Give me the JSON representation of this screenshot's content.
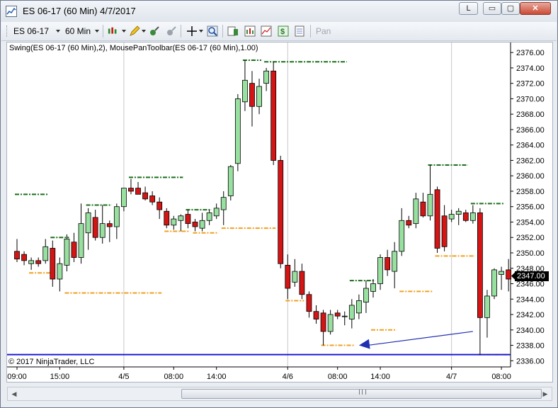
{
  "window": {
    "title": "ES 06-17 (60 Min)  4/7/2017",
    "buttons": {
      "l": "L",
      "minimize": "▭",
      "maximize": "▢",
      "close": "✕"
    }
  },
  "toolbar": {
    "instrument": "ES 06-17",
    "interval": "60 Min",
    "pan_label": "Pan",
    "icons": [
      "bar-type-icon",
      "drawing-pencil-icon",
      "strategy-icon",
      "indicator-icon",
      "crosshair-icon",
      "zoom-icon",
      "data-box-icon",
      "chart-properties-icon",
      "trade-icon",
      "dollar-icon",
      "template-icon"
    ]
  },
  "chart": {
    "indicator_label": "Swing(ES 06-17 (60 Min),2), MousePanToolbar(ES 06-17 (60 Min),1.00)",
    "copyright": "© 2017 NinjaTrader, LLC",
    "last_price": "2347.00",
    "colors": {
      "up": "#98e0a0",
      "down": "#d31515",
      "swing_high": "#1a6e1a",
      "swing_low": "#f0a020",
      "reference_line": "#1a1ad0",
      "arrow": "#2030b0"
    }
  },
  "chart_data": {
    "type": "candlestick",
    "instrument": "ES 06-17",
    "interval": "60 Min",
    "y_ticks": [
      2336,
      2338,
      2340,
      2342,
      2344,
      2346,
      2348,
      2350,
      2352,
      2354,
      2356,
      2358,
      2360,
      2362,
      2364,
      2366,
      2368,
      2370,
      2372,
      2374,
      2376
    ],
    "y_tick_labels": [
      "2336.00",
      "2338.00",
      "2340.00",
      "2342.00",
      "2344.00",
      "2346.00",
      "2348.00",
      "2350.00",
      "2352.00",
      "2354.00",
      "2356.00",
      "2358.00",
      "2360.00",
      "2362.00",
      "2364.00",
      "2366.00",
      "2368.00",
      "2370.00",
      "2372.00",
      "2374.00",
      "2376.00"
    ],
    "ylim": [
      2335.2,
      2377.3
    ],
    "x_labels": [
      "09:00",
      "15:00",
      "4/5",
      "08:00",
      "14:00",
      "4/6",
      "08:00",
      "14:00",
      "4/7",
      "08:00"
    ],
    "x_label_bars": [
      0,
      6,
      15,
      22,
      28,
      38,
      45,
      51,
      61,
      68
    ],
    "separator_bars": [
      15,
      38,
      61
    ],
    "candles": [
      {
        "o": 2350.2,
        "h": 2351.8,
        "l": 2348.8,
        "c": 2349.2
      },
      {
        "o": 2349.8,
        "h": 2350.2,
        "l": 2348.4,
        "c": 2349.0
      },
      {
        "o": 2348.6,
        "h": 2349.4,
        "l": 2347.8,
        "c": 2349.0
      },
      {
        "o": 2349.0,
        "h": 2349.4,
        "l": 2348.2,
        "c": 2348.6
      },
      {
        "o": 2349.0,
        "h": 2351.8,
        "l": 2348.6,
        "c": 2350.8
      },
      {
        "o": 2350.6,
        "h": 2351.6,
        "l": 2345.6,
        "c": 2346.6
      },
      {
        "o": 2346.6,
        "h": 2349.4,
        "l": 2345.0,
        "c": 2348.6
      },
      {
        "o": 2348.4,
        "h": 2352.4,
        "l": 2347.6,
        "c": 2351.8
      },
      {
        "o": 2351.4,
        "h": 2352.6,
        "l": 2348.8,
        "c": 2349.4
      },
      {
        "o": 2349.4,
        "h": 2356.4,
        "l": 2348.6,
        "c": 2353.8
      },
      {
        "o": 2352.6,
        "h": 2355.8,
        "l": 2350.4,
        "c": 2355.2
      },
      {
        "o": 2354.6,
        "h": 2355.6,
        "l": 2351.6,
        "c": 2352.0
      },
      {
        "o": 2352.0,
        "h": 2356.2,
        "l": 2351.2,
        "c": 2353.8
      },
      {
        "o": 2353.8,
        "h": 2354.2,
        "l": 2351.4,
        "c": 2353.4
      },
      {
        "o": 2353.4,
        "h": 2356.4,
        "l": 2351.8,
        "c": 2356.0
      },
      {
        "o": 2356.0,
        "h": 2358.4,
        "l": 2355.4,
        "c": 2358.4
      },
      {
        "o": 2358.4,
        "h": 2359.6,
        "l": 2357.6,
        "c": 2358.0
      },
      {
        "o": 2358.4,
        "h": 2359.2,
        "l": 2357.6,
        "c": 2357.6
      },
      {
        "o": 2357.8,
        "h": 2358.6,
        "l": 2356.8,
        "c": 2357.0
      },
      {
        "o": 2357.4,
        "h": 2358.0,
        "l": 2356.2,
        "c": 2356.6
      },
      {
        "o": 2356.6,
        "h": 2357.2,
        "l": 2354.4,
        "c": 2355.6
      },
      {
        "o": 2355.4,
        "h": 2355.8,
        "l": 2353.2,
        "c": 2353.6
      },
      {
        "o": 2353.6,
        "h": 2354.8,
        "l": 2353.0,
        "c": 2354.4
      },
      {
        "o": 2354.2,
        "h": 2355.0,
        "l": 2352.8,
        "c": 2354.8
      },
      {
        "o": 2355.0,
        "h": 2355.6,
        "l": 2353.2,
        "c": 2353.8
      },
      {
        "o": 2354.0,
        "h": 2354.4,
        "l": 2352.8,
        "c": 2353.4
      },
      {
        "o": 2353.2,
        "h": 2355.2,
        "l": 2352.8,
        "c": 2354.2
      },
      {
        "o": 2354.2,
        "h": 2355.6,
        "l": 2353.6,
        "c": 2355.2
      },
      {
        "o": 2354.8,
        "h": 2356.4,
        "l": 2354.4,
        "c": 2355.8
      },
      {
        "o": 2355.6,
        "h": 2358.0,
        "l": 2353.6,
        "c": 2357.2
      },
      {
        "o": 2357.4,
        "h": 2361.4,
        "l": 2356.8,
        "c": 2361.2
      },
      {
        "o": 2361.6,
        "h": 2370.6,
        "l": 2360.6,
        "c": 2370.0
      },
      {
        "o": 2369.6,
        "h": 2375.0,
        "l": 2368.4,
        "c": 2372.4
      },
      {
        "o": 2372.0,
        "h": 2373.6,
        "l": 2366.4,
        "c": 2369.0
      },
      {
        "o": 2369.0,
        "h": 2372.6,
        "l": 2368.0,
        "c": 2371.6
      },
      {
        "o": 2372.0,
        "h": 2374.0,
        "l": 2371.0,
        "c": 2373.6
      },
      {
        "o": 2373.6,
        "h": 2374.8,
        "l": 2361.4,
        "c": 2362.0
      },
      {
        "o": 2362.0,
        "h": 2362.6,
        "l": 2348.0,
        "c": 2348.6
      },
      {
        "o": 2348.4,
        "h": 2349.8,
        "l": 2344.0,
        "c": 2345.4
      },
      {
        "o": 2346.2,
        "h": 2349.2,
        "l": 2345.6,
        "c": 2347.6
      },
      {
        "o": 2347.6,
        "h": 2348.6,
        "l": 2344.0,
        "c": 2344.6
      },
      {
        "o": 2344.6,
        "h": 2345.0,
        "l": 2341.6,
        "c": 2342.4
      },
      {
        "o": 2342.4,
        "h": 2343.2,
        "l": 2340.8,
        "c": 2341.4
      },
      {
        "o": 2342.2,
        "h": 2342.6,
        "l": 2338.0,
        "c": 2339.8
      },
      {
        "o": 2339.8,
        "h": 2342.6,
        "l": 2339.4,
        "c": 2342.0
      },
      {
        "o": 2342.2,
        "h": 2342.6,
        "l": 2341.4,
        "c": 2341.8
      },
      {
        "o": 2341.8,
        "h": 2342.4,
        "l": 2340.6,
        "c": 2341.8
      },
      {
        "o": 2341.4,
        "h": 2344.0,
        "l": 2340.2,
        "c": 2343.2
      },
      {
        "o": 2342.2,
        "h": 2344.6,
        "l": 2341.4,
        "c": 2343.8
      },
      {
        "o": 2343.6,
        "h": 2346.4,
        "l": 2342.2,
        "c": 2345.4
      },
      {
        "o": 2345.0,
        "h": 2346.6,
        "l": 2344.2,
        "c": 2346.0
      },
      {
        "o": 2346.0,
        "h": 2349.8,
        "l": 2345.2,
        "c": 2349.4
      },
      {
        "o": 2349.4,
        "h": 2350.4,
        "l": 2347.0,
        "c": 2347.8
      },
      {
        "o": 2347.6,
        "h": 2351.4,
        "l": 2345.4,
        "c": 2350.2
      },
      {
        "o": 2350.2,
        "h": 2355.8,
        "l": 2349.6,
        "c": 2354.2
      },
      {
        "o": 2354.2,
        "h": 2354.8,
        "l": 2353.2,
        "c": 2353.6
      },
      {
        "o": 2353.8,
        "h": 2357.8,
        "l": 2353.2,
        "c": 2357.0
      },
      {
        "o": 2356.6,
        "h": 2357.8,
        "l": 2354.6,
        "c": 2354.8
      },
      {
        "o": 2354.8,
        "h": 2361.4,
        "l": 2354.2,
        "c": 2357.6
      },
      {
        "o": 2358.2,
        "h": 2358.6,
        "l": 2350.0,
        "c": 2350.6
      },
      {
        "o": 2354.8,
        "h": 2356.2,
        "l": 2350.2,
        "c": 2350.8
      },
      {
        "o": 2354.4,
        "h": 2355.6,
        "l": 2354.0,
        "c": 2355.0
      },
      {
        "o": 2355.0,
        "h": 2355.8,
        "l": 2353.6,
        "c": 2355.4
      },
      {
        "o": 2355.2,
        "h": 2355.6,
        "l": 2354.0,
        "c": 2354.2
      },
      {
        "o": 2354.2,
        "h": 2356.2,
        "l": 2353.8,
        "c": 2355.2
      },
      {
        "o": 2355.2,
        "h": 2355.8,
        "l": 2336.8,
        "c": 2341.6
      },
      {
        "o": 2341.6,
        "h": 2345.2,
        "l": 2339.0,
        "c": 2344.4
      },
      {
        "o": 2344.4,
        "h": 2348.0,
        "l": 2344.0,
        "c": 2347.8
      },
      {
        "o": 2347.2,
        "h": 2348.2,
        "l": 2345.2,
        "c": 2347.6
      },
      {
        "o": 2347.8,
        "h": 2349.2,
        "l": 2345.0,
        "c": 2346.6
      },
      {
        "o": 2346.8,
        "h": 2347.4,
        "l": 2346.4,
        "c": 2347.0
      }
    ],
    "swing_highs": [
      {
        "price": 2357.6,
        "from": 0,
        "to": 4
      },
      {
        "price": 2352.0,
        "from": 5,
        "to": 7
      },
      {
        "price": 2356.2,
        "from": 10,
        "to": 13
      },
      {
        "price": 2359.8,
        "from": 16,
        "to": 23
      },
      {
        "price": 2355.6,
        "from": 24,
        "to": 27
      },
      {
        "price": 2375.0,
        "from": 32,
        "to": 34
      },
      {
        "price": 2374.8,
        "from": 35,
        "to": 46
      },
      {
        "price": 2346.4,
        "from": 47,
        "to": 50
      },
      {
        "price": 2361.4,
        "from": 58,
        "to": 63
      },
      {
        "price": 2356.4,
        "from": 64,
        "to": 68
      }
    ],
    "swing_lows": [
      {
        "price": 2347.4,
        "from": 2,
        "to": 5
      },
      {
        "price": 2344.8,
        "from": 7,
        "to": 20
      },
      {
        "price": 2352.8,
        "from": 21,
        "to": 24
      },
      {
        "price": 2352.6,
        "from": 25,
        "to": 28
      },
      {
        "price": 2353.2,
        "from": 29,
        "to": 36
      },
      {
        "price": 2343.8,
        "from": 38,
        "to": 40
      },
      {
        "price": 2338.0,
        "from": 43,
        "to": 47
      },
      {
        "price": 2340.0,
        "from": 50,
        "to": 53
      },
      {
        "price": 2345.0,
        "from": 54,
        "to": 58
      },
      {
        "price": 2349.6,
        "from": 59,
        "to": 64
      },
      {
        "price": 2336.8,
        "from": 65,
        "to": 69
      }
    ],
    "reference_line": {
      "price": 2336.8
    },
    "arrow": {
      "from": {
        "bar": 64,
        "price": 2339.8
      },
      "to": {
        "bar": 48,
        "price": 2338.0
      }
    }
  }
}
